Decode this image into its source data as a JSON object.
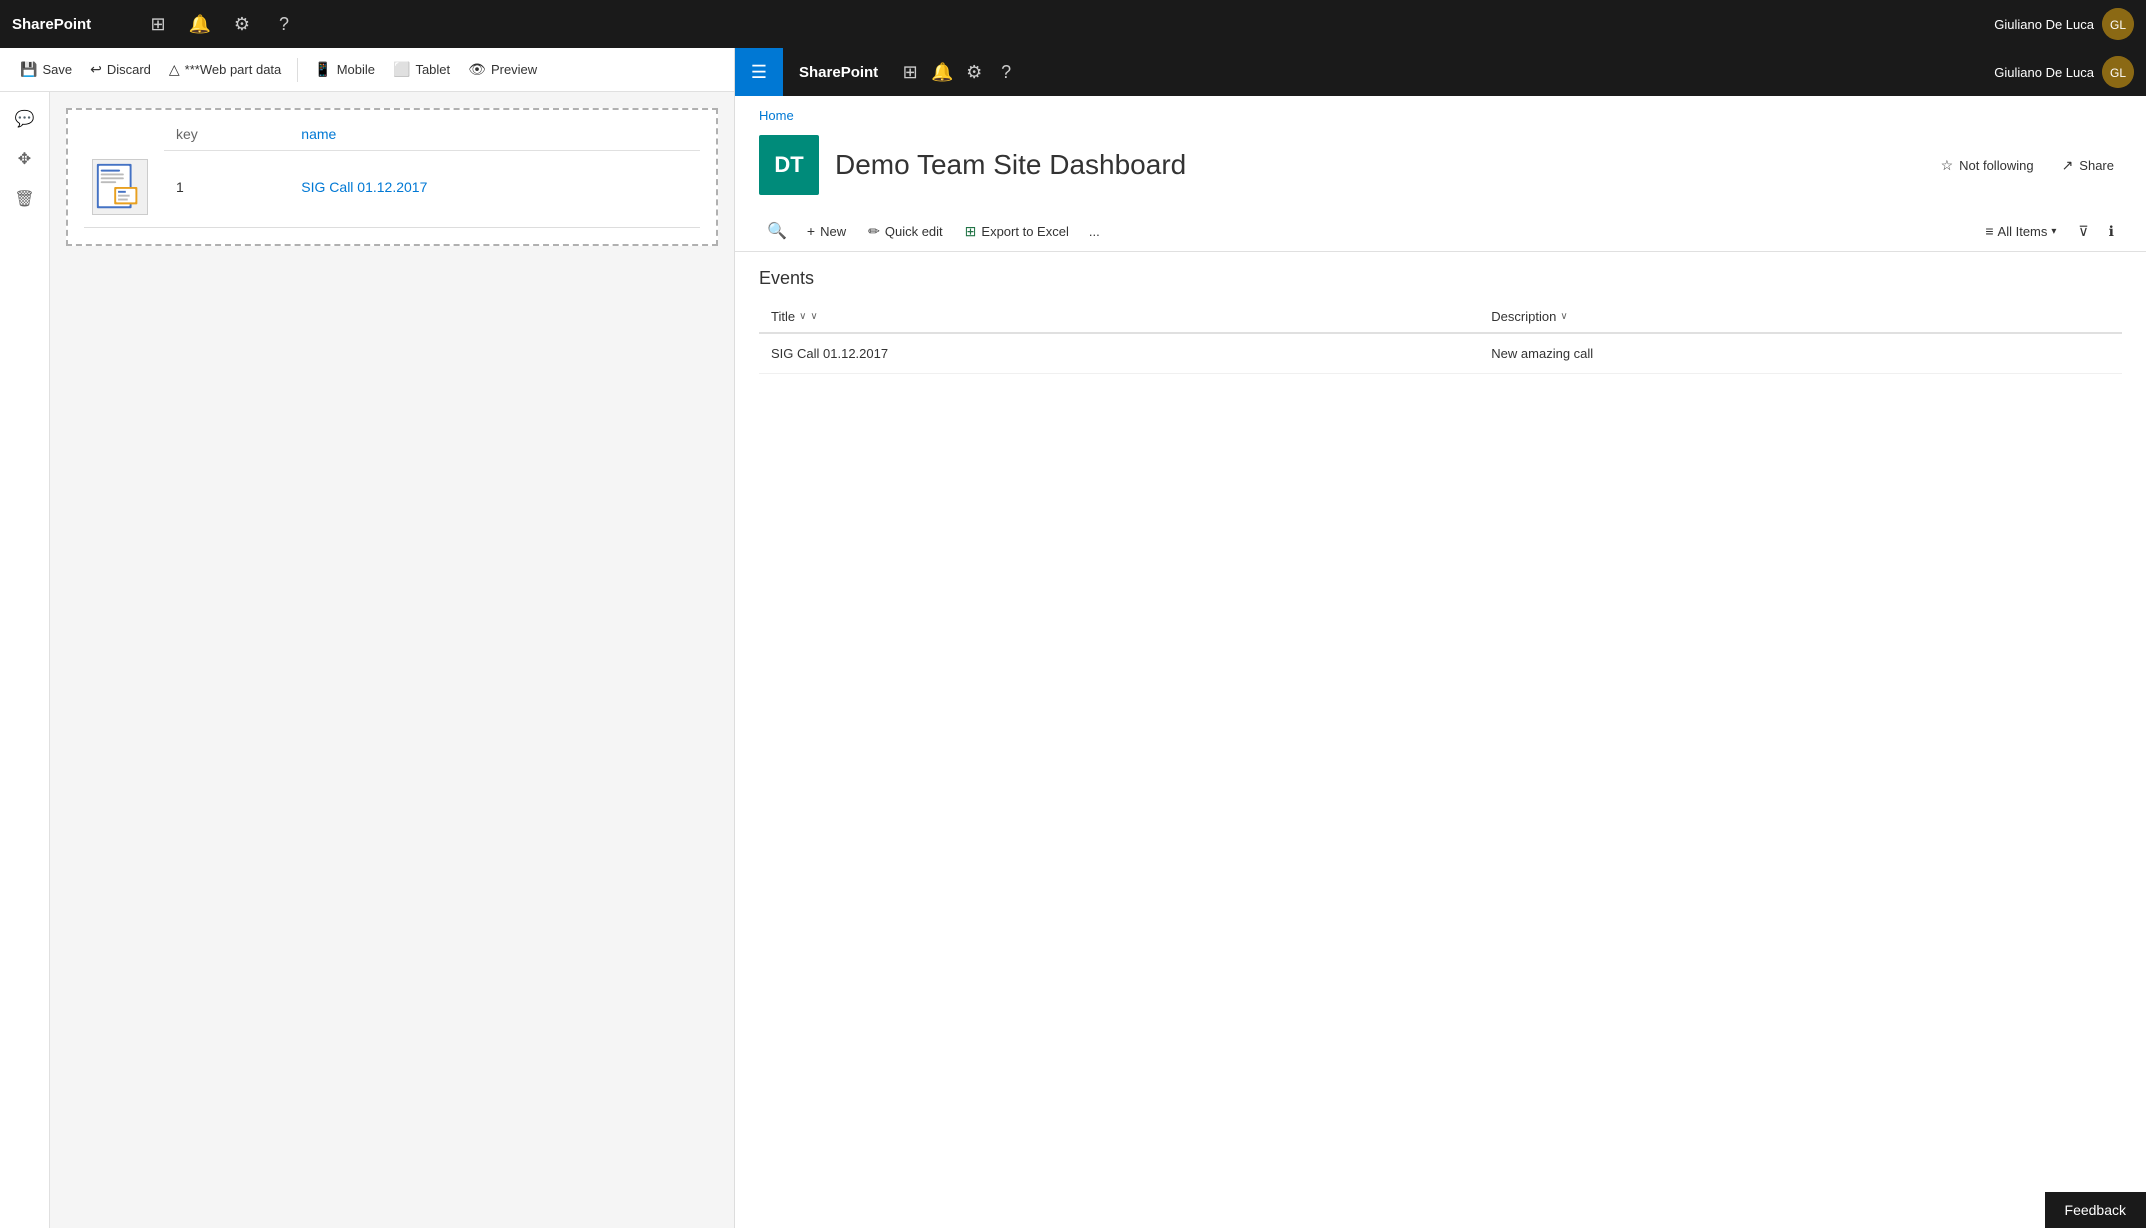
{
  "leftNav": {
    "brand": "SharePoint",
    "icons": [
      "grid",
      "bell",
      "gear",
      "question"
    ]
  },
  "rightNav": {
    "brand": "SharePoint",
    "icons": [
      "grid",
      "bell",
      "gear",
      "question"
    ]
  },
  "user": {
    "name": "Giuliano De Luca"
  },
  "editorToolbar": {
    "save": "Save",
    "discard": "Discard",
    "webPartData": "***Web part data",
    "mobile": "Mobile",
    "tablet": "Tablet",
    "preview": "Preview"
  },
  "dataTable": {
    "columns": [
      "key",
      "name"
    ],
    "rows": [
      {
        "key": "1",
        "name": "SIG Call 01.12.2017",
        "hasThumbnail": true
      }
    ]
  },
  "site": {
    "breadcrumb": "Home",
    "logoText": "DT",
    "logoColor": "#008b7a",
    "title": "Demo Team Site Dashboard",
    "notFollowing": "Not following",
    "share": "Share"
  },
  "listToolbar": {
    "search": "",
    "new": "New",
    "quickEdit": "Quick edit",
    "exportToExcel": "Export to Excel",
    "more": "...",
    "allItems": "All Items",
    "filter": "",
    "info": ""
  },
  "events": {
    "title": "Events",
    "columns": [
      {
        "label": "Title",
        "sortable": true
      },
      {
        "label": "Description",
        "sortable": true
      }
    ],
    "rows": [
      {
        "title": "SIG Call 01.12.2017",
        "description": "New amazing call"
      }
    ]
  },
  "feedback": {
    "label": "Feedback"
  }
}
